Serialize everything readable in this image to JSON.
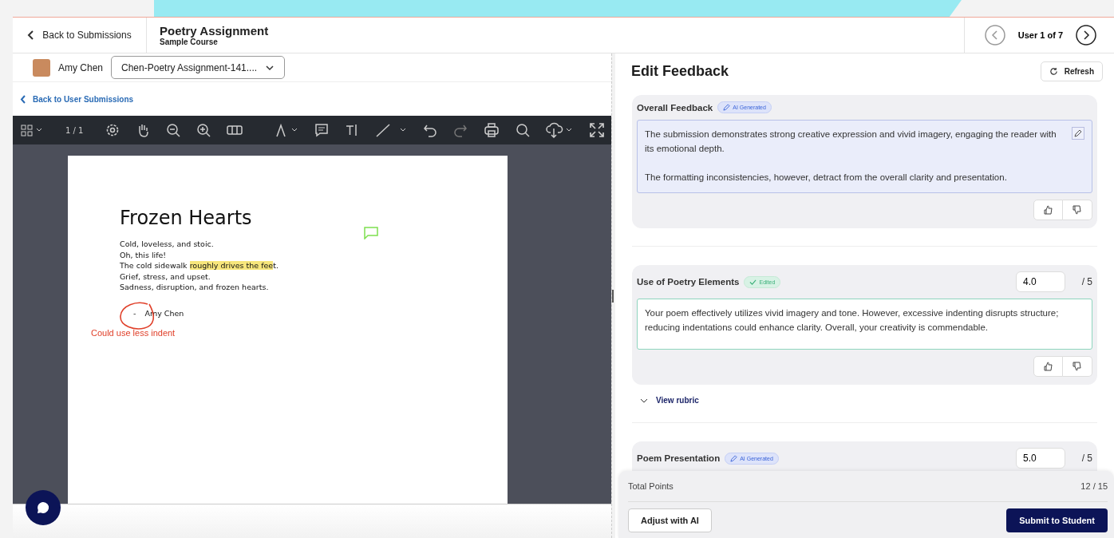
{
  "header": {
    "back_label": "Back to Submissions",
    "title": "Poetry Assignment",
    "course": "Sample Course",
    "pager": "User 1 of 7"
  },
  "submission": {
    "student": "Amy Chen",
    "file": "Chen-Poetry Assignment-141....",
    "back_link": "Back to User Submissions",
    "page_counter": "1 / 1"
  },
  "document": {
    "title": "Frozen Hearts",
    "lines": [
      [
        {
          "text": "Cold, loveless, and stoic.",
          "highlighted": false
        }
      ],
      [
        {
          "text": "Oh, this life!",
          "highlighted": false
        }
      ],
      [
        {
          "text": "The cold sidewalk ",
          "highlighted": false
        },
        {
          "text": "roughly drives the fee",
          "highlighted": true
        },
        {
          "text": "t.",
          "highlighted": false
        }
      ],
      [
        {
          "text": "Grief, stress, and upset.",
          "highlighted": false
        }
      ],
      [
        {
          "text": "Sadness, disruption, and frozen hearts.",
          "highlighted": false
        }
      ]
    ],
    "author_dash": "-",
    "author": "Amy Chen",
    "annotation": "Could use less indent"
  },
  "feedback": {
    "title": "Edit Feedback",
    "refresh": "Refresh",
    "sections": [
      {
        "title": "Overall Feedback",
        "badge": {
          "kind": "ai",
          "label": "AI Generated"
        },
        "text": "The submission demonstrates strong creative expression and vivid imagery, engaging the reader with its emotional depth.\n\nThe formatting inconsistencies, however, detract from the overall clarity and presentation."
      },
      {
        "title": "Use of Poetry Elements",
        "badge": {
          "kind": "edited",
          "label": "Edited"
        },
        "score": "4.0",
        "max": "/ 5",
        "text": "Your poem effectively utilizes vivid imagery and tone. However, excessive indenting disrupts structure; reducing indentations could enhance clarity. Overall, your creativity is commendable.",
        "rubric_link": "View rubric"
      },
      {
        "title": "Poem Presentation",
        "badge": {
          "kind": "ai",
          "label": "AI Generated"
        },
        "score": "5.0",
        "max": "/ 5"
      }
    ]
  },
  "footer": {
    "total_label": "Total Points",
    "total": "12 / 15",
    "adjust": "Adjust with AI",
    "submit": "Submit to Student"
  }
}
